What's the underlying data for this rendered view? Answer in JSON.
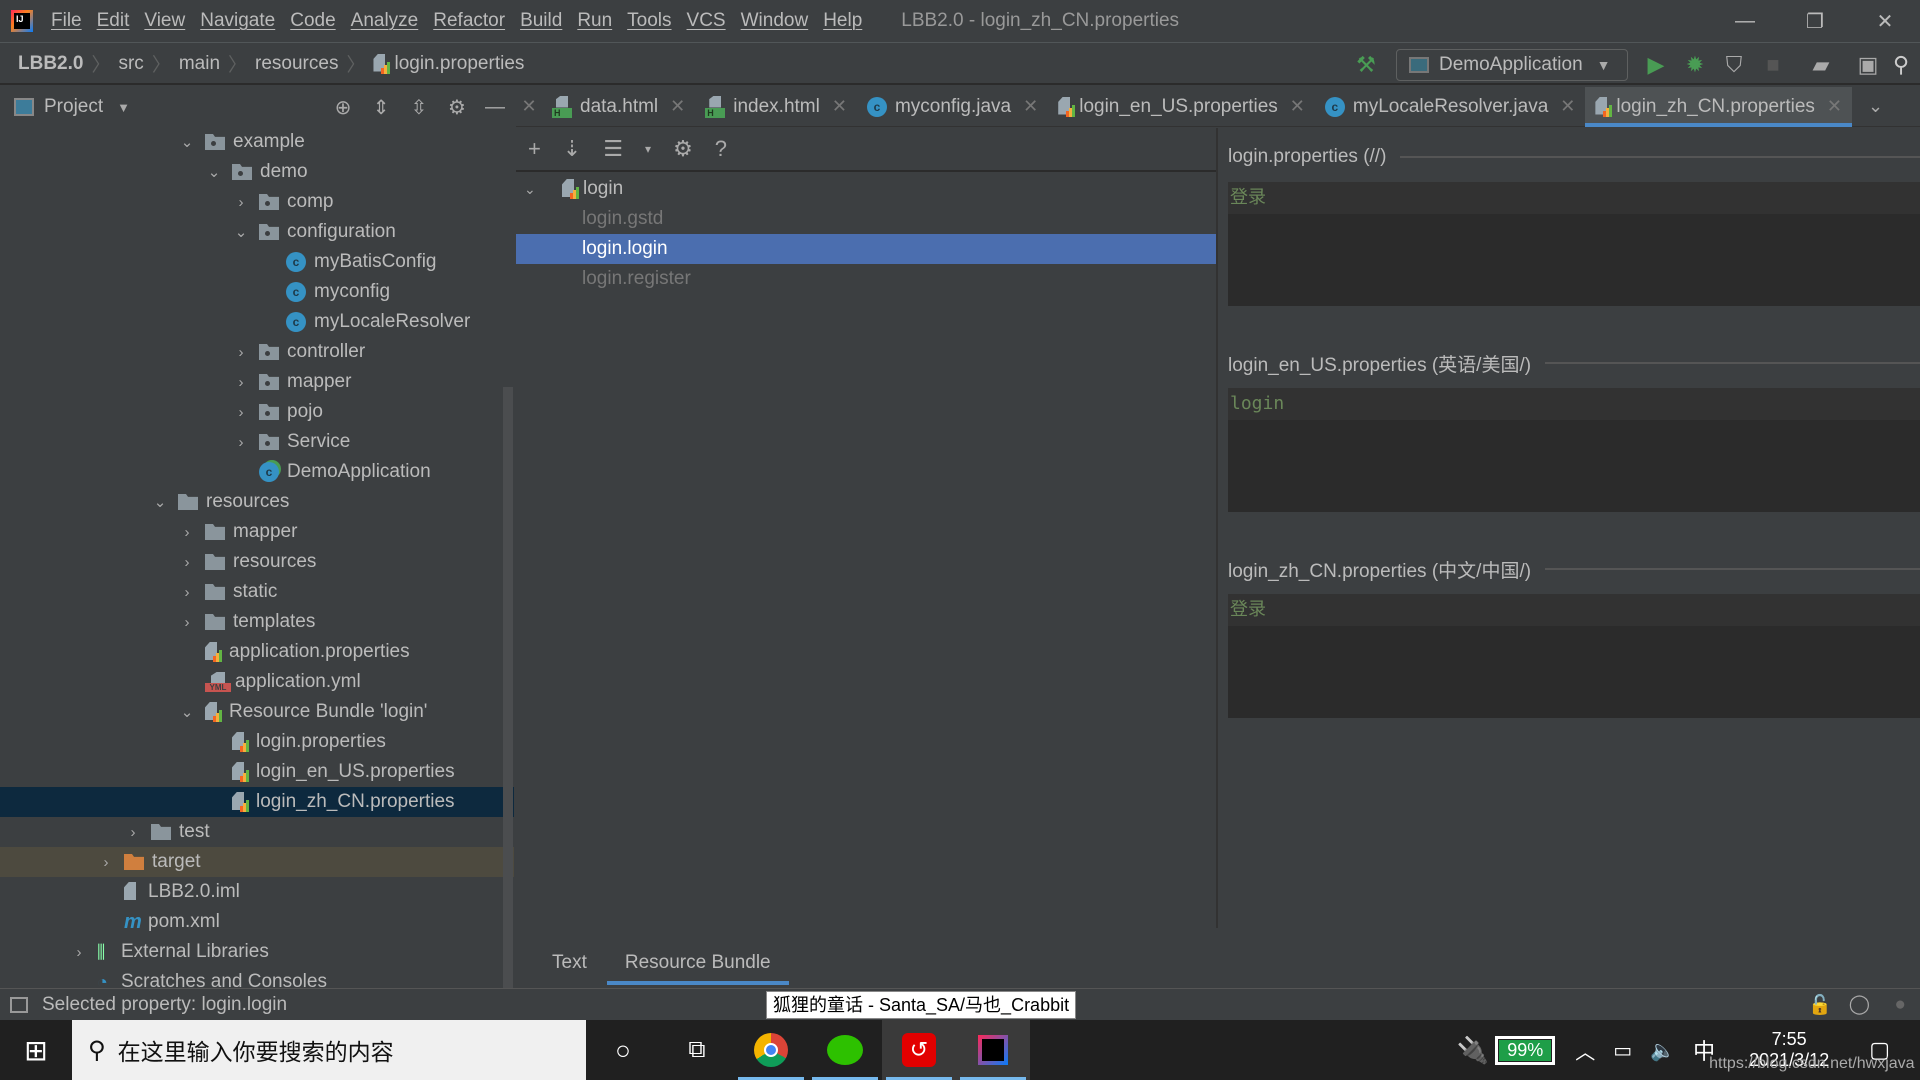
{
  "window": {
    "title": "LBB2.0 - login_zh_CN.properties",
    "menu": [
      "File",
      "Edit",
      "View",
      "Navigate",
      "Code",
      "Analyze",
      "Refactor",
      "Build",
      "Run",
      "Tools",
      "VCS",
      "Window",
      "Help"
    ],
    "controls": {
      "minimize": "—",
      "restore": "❐",
      "close": "✕"
    }
  },
  "breadcrumb": [
    "LBB2.0",
    "src",
    "main",
    "resources",
    "login.properties"
  ],
  "toolbar": {
    "run_config": "DemoApplication",
    "icons": [
      "build-hammer-icon",
      "run-icon",
      "debug-icon",
      "coverage-icon",
      "stop-icon",
      "project-structure-icon",
      "terminal-icon",
      "search-icon"
    ]
  },
  "project": {
    "title": "Project",
    "tree": [
      {
        "label": "example",
        "indent": 1,
        "arrow": "down",
        "icon": "package"
      },
      {
        "label": "demo",
        "indent": 2,
        "arrow": "down",
        "icon": "package"
      },
      {
        "label": "comp",
        "indent": 3,
        "arrow": "right",
        "icon": "package"
      },
      {
        "label": "configuration",
        "indent": 3,
        "arrow": "down",
        "icon": "package"
      },
      {
        "label": "myBatisConfig",
        "indent": 4,
        "arrow": "",
        "icon": "class"
      },
      {
        "label": "myconfig",
        "indent": 4,
        "arrow": "",
        "icon": "class"
      },
      {
        "label": "myLocaleResolver",
        "indent": 4,
        "arrow": "",
        "icon": "class"
      },
      {
        "label": "controller",
        "indent": 3,
        "arrow": "right",
        "icon": "package"
      },
      {
        "label": "mapper",
        "indent": 3,
        "arrow": "right",
        "icon": "package"
      },
      {
        "label": "pojo",
        "indent": 3,
        "arrow": "right",
        "icon": "package"
      },
      {
        "label": "Service",
        "indent": 3,
        "arrow": "right",
        "icon": "package"
      },
      {
        "label": "DemoApplication",
        "indent": 3,
        "arrow": "",
        "icon": "app-class"
      },
      {
        "label": "resources",
        "indent": 0,
        "arrow": "down",
        "icon": "resources"
      },
      {
        "label": "mapper",
        "indent": 1,
        "arrow": "right",
        "icon": "folder"
      },
      {
        "label": "resources",
        "indent": 1,
        "arrow": "right",
        "icon": "folder"
      },
      {
        "label": "static",
        "indent": 1,
        "arrow": "right",
        "icon": "folder"
      },
      {
        "label": "templates",
        "indent": 1,
        "arrow": "right",
        "icon": "folder"
      },
      {
        "label": "application.properties",
        "indent": 1,
        "arrow": "",
        "icon": "properties"
      },
      {
        "label": "application.yml",
        "indent": 1,
        "arrow": "",
        "icon": "yml"
      },
      {
        "label": "Resource Bundle 'login'",
        "indent": 1,
        "arrow": "down",
        "icon": "bundle"
      },
      {
        "label": "login.properties",
        "indent": 2,
        "arrow": "",
        "icon": "properties"
      },
      {
        "label": "login_en_US.properties",
        "indent": 2,
        "arrow": "",
        "icon": "properties"
      },
      {
        "label": "login_zh_CN.properties",
        "indent": 2,
        "arrow": "",
        "icon": "properties",
        "selected": true
      },
      {
        "label": "test",
        "indent": -1,
        "arrow": "right",
        "icon": "folder"
      },
      {
        "label": "target",
        "indent": -2,
        "arrow": "right",
        "icon": "folder-orange",
        "highlight": true
      },
      {
        "label": "LBB2.0.iml",
        "indent": -2,
        "arrow": "",
        "icon": "file"
      },
      {
        "label": "pom.xml",
        "indent": -2,
        "arrow": "",
        "icon": "maven"
      },
      {
        "label": "External Libraries",
        "indent": -3,
        "arrow": "right",
        "icon": "libraries"
      },
      {
        "label": "Scratches and Consoles",
        "indent": -3,
        "arrow": "",
        "icon": "scratches"
      }
    ]
  },
  "tabs": [
    {
      "label": "data.html",
      "icon": "html"
    },
    {
      "label": "index.html",
      "icon": "html"
    },
    {
      "label": "myconfig.java",
      "icon": "class"
    },
    {
      "label": "login_en_US.properties",
      "icon": "properties"
    },
    {
      "label": "myLocaleResolver.java",
      "icon": "class"
    },
    {
      "label": "login_zh_CN.properties",
      "icon": "properties",
      "active": true
    }
  ],
  "bundle_editor": {
    "root": "login",
    "keys": [
      {
        "label": "login.gstd",
        "selected": false
      },
      {
        "label": "login.login",
        "selected": true
      },
      {
        "label": "login.register",
        "selected": false
      }
    ],
    "properties": [
      {
        "title": "login.properties (//)",
        "value": "登录"
      },
      {
        "title": "login_en_US.properties (英语/美国/)",
        "value": "login"
      },
      {
        "title": "login_zh_CN.properties (中文/中国/)",
        "value": "登录"
      }
    ],
    "bottom_tabs": [
      {
        "label": "Text",
        "active": false
      },
      {
        "label": "Resource Bundle",
        "active": true
      }
    ]
  },
  "status": {
    "text": "Selected property: login.login",
    "tooltip": "狐狸的童话 - Santa_SA/马也_Crabbit"
  },
  "taskbar": {
    "search_placeholder": "在这里输入你要搜索的内容",
    "battery": "99%",
    "ime": "中",
    "time": "7:55",
    "date": "2021/3/12",
    "watermark": "https://blog.csdn.net/hwxjava"
  }
}
